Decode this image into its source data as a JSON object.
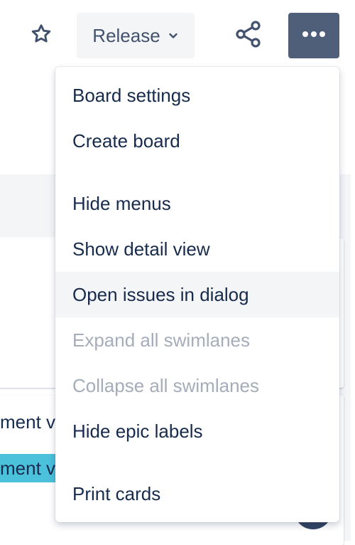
{
  "toolbar": {
    "star_icon": "star-icon",
    "release_label": "Release",
    "release_chevron_icon": "chevron-down-icon",
    "share_icon": "share-icon",
    "more_icon": "more-horizontal-icon",
    "more_active_color": "#505f79"
  },
  "menu": {
    "groups": [
      [
        {
          "label": "Board settings",
          "state": "normal"
        },
        {
          "label": "Create board",
          "state": "normal"
        }
      ],
      [
        {
          "label": "Hide menus",
          "state": "normal"
        },
        {
          "label": "Show detail view",
          "state": "normal"
        },
        {
          "label": "Open issues in dialog",
          "state": "hovered"
        },
        {
          "label": "Expand all swimlanes",
          "state": "disabled"
        },
        {
          "label": "Collapse all swimlanes",
          "state": "disabled"
        },
        {
          "label": "Hide epic labels",
          "state": "normal"
        }
      ],
      [
        {
          "label": "Print cards",
          "state": "normal"
        }
      ]
    ]
  },
  "background": {
    "card_text": "ment v",
    "label_text": "ment v",
    "label_color": "#4bc1dc"
  }
}
